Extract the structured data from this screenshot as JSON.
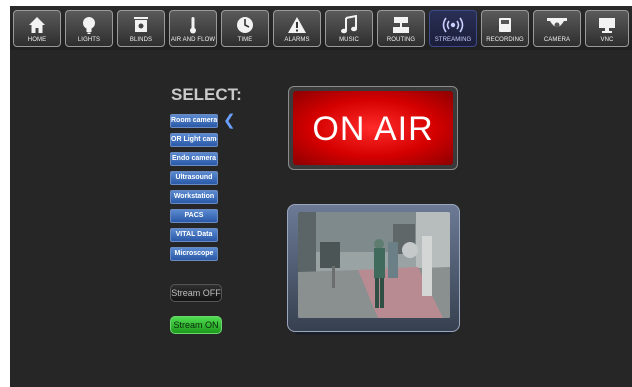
{
  "nav": {
    "items": [
      {
        "label": "HOME",
        "icon": "home-icon"
      },
      {
        "label": "LIGHTS",
        "icon": "lightbulb-icon"
      },
      {
        "label": "BLINDS",
        "icon": "blinds-icon"
      },
      {
        "label": "AIR AND FLOW",
        "icon": "thermometer-icon"
      },
      {
        "label": "TIME",
        "icon": "clock-icon"
      },
      {
        "label": "ALARMS",
        "icon": "warning-icon"
      },
      {
        "label": "MUSIC",
        "icon": "music-note-icon"
      },
      {
        "label": "ROUTING",
        "icon": "routing-icon"
      },
      {
        "label": "STREAMING",
        "icon": "broadcast-icon"
      },
      {
        "label": "RECORDING",
        "icon": "recording-icon"
      },
      {
        "label": "CAMERA",
        "icon": "camera-icon"
      },
      {
        "label": "VNC",
        "icon": "monitor-icon"
      }
    ],
    "active": "STREAMING"
  },
  "select": {
    "title": "SELECT:",
    "sources": [
      "Room camera",
      "OR Light camera",
      "Endo camera",
      "Ultrasound",
      "Workstation",
      "PACS",
      "VITAL Data",
      "Microscope"
    ],
    "selected": "Room camera"
  },
  "stream": {
    "off_label": "Stream OFF",
    "on_label": "Stream ON",
    "state": "on"
  },
  "status": {
    "on_air": "ON AIR"
  },
  "colors": {
    "background": "#262626",
    "accent_blue": "#2a5aa8",
    "on_air_red": "#e00000",
    "stream_on_green": "#2fb82f"
  }
}
